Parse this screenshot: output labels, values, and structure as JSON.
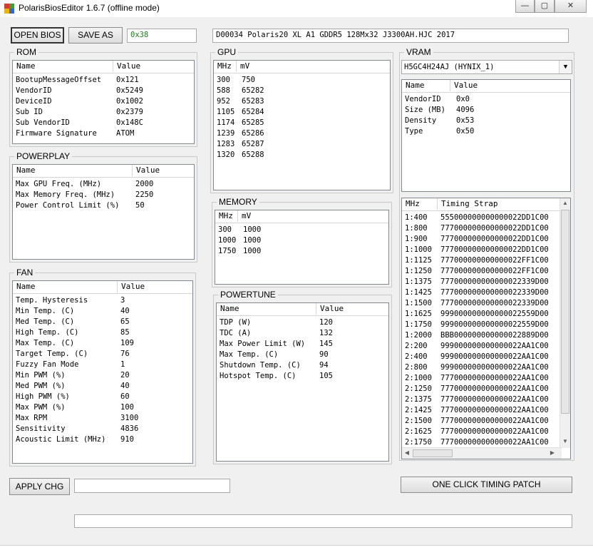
{
  "window": {
    "title": "PolarisBiosEditor 1.6.7 (offline mode)",
    "minimize": "—",
    "maximize": "▢",
    "close": "✕"
  },
  "toolbar": {
    "open_label": "OPEN BIOS",
    "save_label": "SAVE AS",
    "checksum_value": "0x38",
    "bios_name_value": "D00034 Polaris20 XL A1 GDDR5 128Mx32 J3300AH.HJC 2017"
  },
  "rom": {
    "legend": "ROM",
    "columns": [
      "Name",
      "Value"
    ],
    "rows": [
      [
        "BootupMessageOffset",
        "0x121"
      ],
      [
        "VendorID",
        "0x5249"
      ],
      [
        "DeviceID",
        "0x1002"
      ],
      [
        "Sub ID",
        "0x2379"
      ],
      [
        "Sub VendorID",
        "0x148C"
      ],
      [
        "Firmware Signature",
        "ATOM"
      ]
    ]
  },
  "powerplay": {
    "legend": "POWERPLAY",
    "columns": [
      "Name",
      "Value"
    ],
    "rows": [
      [
        "Max GPU Freq. (MHz)",
        "2000"
      ],
      [
        "Max Memory Freq. (MHz)",
        "2250"
      ],
      [
        "Power Control Limit (%)",
        "50"
      ]
    ]
  },
  "fan": {
    "legend": "FAN",
    "columns": [
      "Name",
      "Value"
    ],
    "rows": [
      [
        "Temp. Hysteresis",
        "3"
      ],
      [
        "Min Temp. (C)",
        "40"
      ],
      [
        "Med Temp. (C)",
        "65"
      ],
      [
        "High Temp. (C)",
        "85"
      ],
      [
        "Max Temp. (C)",
        "109"
      ],
      [
        "Target Temp. (C)",
        "76"
      ],
      [
        "Fuzzy Fan Mode",
        "1"
      ],
      [
        "Min PWM (%)",
        "20"
      ],
      [
        "Med PWM (%)",
        "40"
      ],
      [
        "High PWM (%)",
        "60"
      ],
      [
        "Max PWM (%)",
        "100"
      ],
      [
        "Max RPM",
        "3100"
      ],
      [
        "Sensitivity",
        "4836"
      ],
      [
        "Acoustic Limit (MHz)",
        "910"
      ]
    ]
  },
  "gpu": {
    "legend": "GPU",
    "columns": [
      "MHz",
      "mV"
    ],
    "rows": [
      [
        "300",
        "750"
      ],
      [
        "588",
        "65282"
      ],
      [
        "952",
        "65283"
      ],
      [
        "1105",
        "65284"
      ],
      [
        "1174",
        "65285"
      ],
      [
        "1239",
        "65286"
      ],
      [
        "1283",
        "65287"
      ],
      [
        "1320",
        "65288"
      ]
    ]
  },
  "memory": {
    "legend": "MEMORY",
    "columns": [
      "MHz",
      "mV"
    ],
    "rows": [
      [
        "300",
        "1000"
      ],
      [
        "1000",
        "1000"
      ],
      [
        "1750",
        "1000"
      ]
    ]
  },
  "powertune": {
    "legend": "POWERTUNE",
    "columns": [
      "Name",
      "Value"
    ],
    "rows": [
      [
        "TDP (W)",
        "120"
      ],
      [
        "TDC (A)",
        "132"
      ],
      [
        "Max Power Limit (W)",
        "145"
      ],
      [
        "Max Temp. (C)",
        "90"
      ],
      [
        "Shutdown Temp. (C)",
        "94"
      ],
      [
        "Hotspot Temp. (C)",
        "105"
      ]
    ]
  },
  "vram": {
    "legend": "VRAM",
    "selected": "H5GC4H24AJ (HYNIX_1)",
    "columns": [
      "Name",
      "Value"
    ],
    "rows": [
      [
        "VendorID",
        "0x0"
      ],
      [
        "Size (MB)",
        "4096"
      ],
      [
        "Density",
        "0x53"
      ],
      [
        "Type",
        "0x50"
      ]
    ]
  },
  "timing": {
    "columns": [
      "MHz",
      "Timing Strap"
    ],
    "rows": [
      [
        "1:400",
        "555000000000000022DD1C00"
      ],
      [
        "1:800",
        "777000000000000022DD1C00"
      ],
      [
        "1:900",
        "777000000000000022DD1C00"
      ],
      [
        "1:1000",
        "777000000000000022DD1C00"
      ],
      [
        "1:1125",
        "777000000000000022FF1C00"
      ],
      [
        "1:1250",
        "777000000000000022FF1C00"
      ],
      [
        "1:1375",
        "777000000000000022339D00"
      ],
      [
        "1:1425",
        "777000000000000022339D00"
      ],
      [
        "1:1500",
        "777000000000000022339D00"
      ],
      [
        "1:1625",
        "999000000000000022559D00"
      ],
      [
        "1:1750",
        "999000000000000022559D00"
      ],
      [
        "1:2000",
        "BBB000000000000022889D00"
      ],
      [
        "2:200",
        "999000000000000022AA1C00"
      ],
      [
        "2:400",
        "999000000000000022AA1C00"
      ],
      [
        "2:800",
        "999000000000000022AA1C00"
      ],
      [
        "2:1000",
        "777000000000000022AA1C00"
      ],
      [
        "2:1250",
        "777000000000000022AA1C00"
      ],
      [
        "2:1375",
        "777000000000000022AA1C00"
      ],
      [
        "2:1425",
        "777000000000000022AA1C00"
      ],
      [
        "2:1500",
        "777000000000000022AA1C00"
      ],
      [
        "2:1625",
        "777000000000000022AA1C00"
      ],
      [
        "2:1750",
        "777000000000000022AA1C00"
      ]
    ]
  },
  "footer": {
    "apply_label": "APPLY CHG",
    "apply_input": "",
    "patch_label": "ONE CLICK TIMING PATCH",
    "status_text": ""
  },
  "colors": {
    "checksum_text": "#1a7f1a",
    "title_bg": "#ffffff",
    "window_bg": "#f0f0f0"
  }
}
